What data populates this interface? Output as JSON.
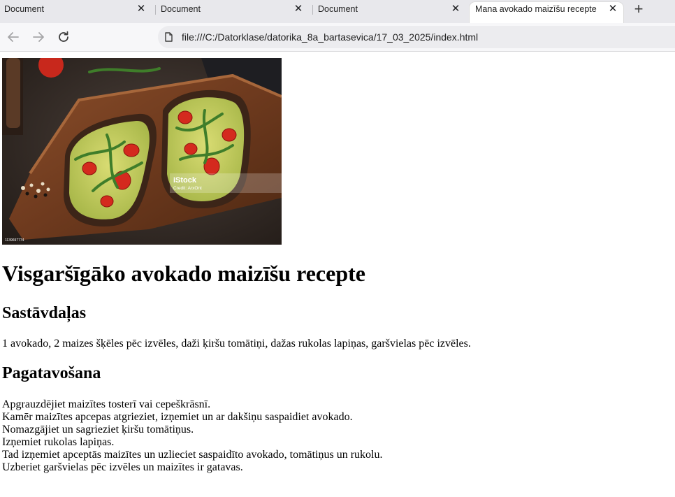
{
  "browser": {
    "tabs": [
      {
        "title": "Document",
        "active": false
      },
      {
        "title": "Document",
        "active": false
      },
      {
        "title": "Document",
        "active": false
      },
      {
        "title": "Mana avokado maizīšu recepte",
        "active": true
      }
    ],
    "close_glyph": "✕",
    "new_tab_glyph": "+",
    "url": "file:///C:/Datorklase/datorika_8a_bartasevica/17_03_2025/index.html",
    "nav_icons": [
      "back-arrow-icon",
      "forward-arrow-icon",
      "reload-icon"
    ]
  },
  "page": {
    "image": {
      "watermark_brand": "iStock",
      "watermark_credit": "Credit: ArxOnt",
      "stock_id": "1139697774"
    },
    "title": "Visgaršīgāko avokado maizīšu recepte",
    "ingredients_heading": "Sastāvdaļas",
    "ingredients_text": "1 avokado, 2 maizes šķēles pēc izvēles, daži ķiršu tomātiņi, dažas rukolas lapiņas, garšvielas pēc izvēles.",
    "preparation_heading": "Pagatavošana",
    "steps": [
      "Apgrauzdējiet maizītes tosterī vai cepeškrāsnī.",
      "Kamēr maizītes apcepas atgrieziet, izņemiet un ar dakšiņu saspaidiet avokado.",
      "Nomazgājiet un sagrieziet ķiršu tomātiņus.",
      "Izņemiet rukolas lapiņas.",
      "Tad izņemiet apceptās maizītes un uzlieciet saspaidīto avokado, tomātiņus un rukolu.",
      "Uzberiet garšvielas pēc izvēles un maizītes ir gatavas."
    ]
  }
}
